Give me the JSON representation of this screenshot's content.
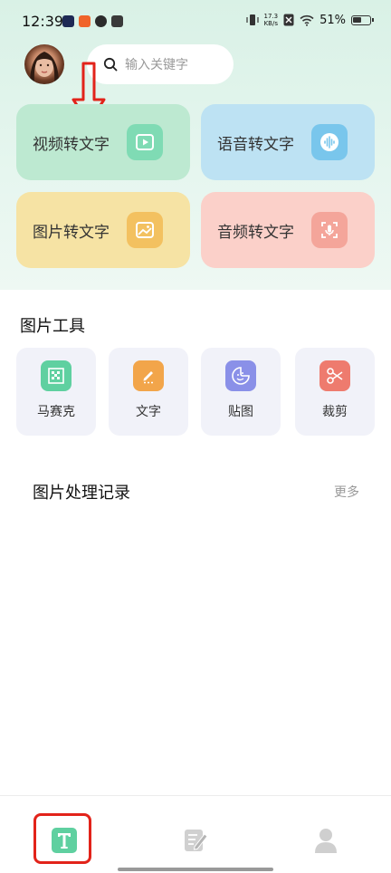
{
  "status_bar": {
    "time": "12:39",
    "net_speed_value": "17.3",
    "net_speed_unit": "KB/s",
    "battery": "51%"
  },
  "search": {
    "placeholder": "输入关键字"
  },
  "features": [
    {
      "label": "视频转文字",
      "icon": "video-play-icon"
    },
    {
      "label": "语音转文字",
      "icon": "voice-wave-icon"
    },
    {
      "label": "图片转文字",
      "icon": "image-icon"
    },
    {
      "label": "音频转文字",
      "icon": "microphone-icon"
    }
  ],
  "image_tools": {
    "title": "图片工具",
    "items": [
      {
        "label": "马赛克",
        "icon": "mosaic-icon",
        "color": "#5fd0a0"
      },
      {
        "label": "文字",
        "icon": "pen-icon",
        "color": "#f2a54a"
      },
      {
        "label": "贴图",
        "icon": "sticker-icon",
        "color": "#8a90e8"
      },
      {
        "label": "裁剪",
        "icon": "scissors-icon",
        "color": "#ee7b6e"
      }
    ]
  },
  "records": {
    "title": "图片处理记录",
    "more": "更多"
  },
  "bottom_nav": [
    {
      "icon": "text-t-icon",
      "active": true
    },
    {
      "icon": "edit-note-icon",
      "active": false
    },
    {
      "icon": "user-icon",
      "active": false
    }
  ],
  "colors": {
    "accent": "#5fd0a0",
    "highlight_annotation": "#e2231a"
  }
}
